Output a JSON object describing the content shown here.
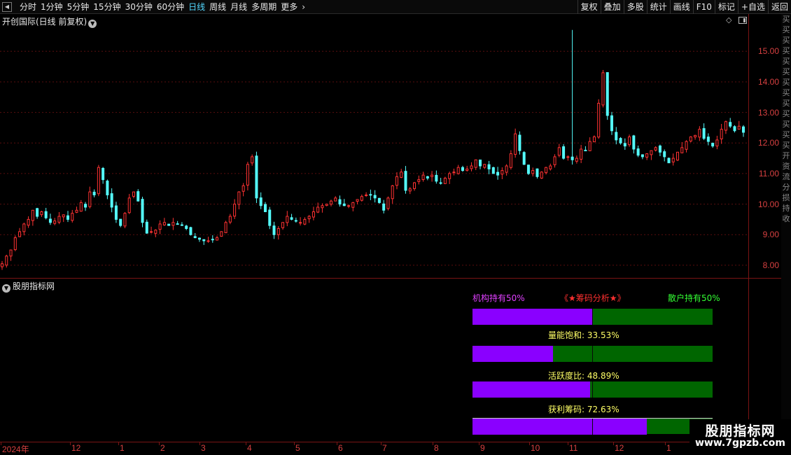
{
  "toolbar": {
    "tabs": [
      {
        "label": "分时",
        "active": false
      },
      {
        "label": "1分钟",
        "active": false
      },
      {
        "label": "5分钟",
        "active": false
      },
      {
        "label": "15分钟",
        "active": false
      },
      {
        "label": "30分钟",
        "active": false
      },
      {
        "label": "60分钟",
        "active": false
      },
      {
        "label": "日线",
        "active": true
      },
      {
        "label": "周线",
        "active": false
      },
      {
        "label": "月线",
        "active": false
      },
      {
        "label": "多周期",
        "active": false
      },
      {
        "label": "更多",
        "active": false
      }
    ],
    "right_buttons": [
      "复权",
      "叠加",
      "多股",
      "统计",
      "画线",
      "F10",
      "标记",
      "+自选",
      "返回"
    ]
  },
  "main_chart": {
    "title": "开创国际(日线 前复权)",
    "price_ticks": [
      "15.00",
      "14.00",
      "13.00",
      "12.00",
      "11.00",
      "10.00",
      "9.00",
      "8.00"
    ],
    "up_color": "#ff3232",
    "down_color": "#54fcfc"
  },
  "right_strip_glyphs": [
    "买",
    "买",
    "买",
    "买",
    "买",
    "买",
    "买",
    "买",
    "买",
    "买",
    "买",
    "买",
    "买",
    "开",
    "资",
    "流",
    "分",
    "损",
    "持",
    "收"
  ],
  "indicator": {
    "title": "股朋指标网",
    "institution_label": "机构持有50%",
    "analysis_title": "《★筹码分析★》",
    "retail_label": "散户持有50%",
    "volume_saturation": {
      "label": "量能饱和:",
      "value": "33.53%"
    },
    "activity_ratio": {
      "label": "活跃度比:",
      "value": "48.89%"
    },
    "profit_chips": {
      "label": "获利筹码:",
      "value": "72.63%"
    },
    "bars": [
      {
        "fill": 0.5
      },
      {
        "fill": 0.3353
      },
      {
        "fill": 0.4889
      },
      {
        "fill": 0.7263
      }
    ]
  },
  "date_axis": [
    "2024年",
    "12",
    "1",
    "2",
    "3",
    "4",
    "5",
    "6",
    "7",
    "8",
    "9",
    "10",
    "11",
    "12",
    "1"
  ],
  "watermark": {
    "title": "股朋指标网",
    "url": "www.7gpzb.com"
  },
  "chart_data": {
    "type": "candlestick",
    "ylim": [
      7.7,
      15.9
    ],
    "price_path": [
      8.05,
      8.3,
      8.5,
      8.9,
      9.1,
      9.35,
      9.5,
      9.8,
      9.6,
      9.75,
      9.55,
      9.4,
      9.45,
      9.6,
      9.65,
      9.5,
      9.7,
      9.8,
      10.05,
      9.9,
      10.4,
      10.3,
      11.2,
      10.8,
      10.3,
      9.9,
      9.5,
      9.3,
      9.7,
      10.2,
      10.4,
      10.1,
      9.4,
      9.05,
      9.1,
      9.15,
      9.35,
      9.4,
      9.3,
      9.4,
      9.35,
      9.3,
      9.2,
      9.0,
      8.9,
      8.85,
      8.8,
      8.8,
      8.85,
      8.9,
      9.1,
      9.4,
      9.6,
      10.0,
      10.4,
      10.6,
      11.3,
      11.55,
      10.2,
      9.95,
      9.75,
      9.3,
      9.0,
      9.2,
      9.4,
      9.6,
      9.5,
      9.45,
      9.4,
      9.5,
      9.6,
      9.75,
      9.9,
      9.95,
      10.0,
      10.1,
      10.2,
      10.0,
      9.95,
      9.95,
      10.05,
      10.15,
      10.25,
      10.3,
      10.3,
      10.2,
      10.05,
      9.8,
      10.2,
      10.6,
      10.9,
      11.05,
      10.45,
      10.5,
      10.7,
      10.8,
      10.95,
      10.85,
      10.95,
      10.75,
      10.7,
      10.85,
      11.0,
      11.05,
      11.2,
      11.1,
      11.15,
      11.25,
      11.45,
      11.25,
      11.3,
      11.15,
      11.0,
      10.95,
      11.1,
      11.25,
      11.65,
      12.3,
      11.75,
      11.3,
      11.0,
      11.1,
      10.9,
      11.05,
      11.2,
      11.25,
      11.55,
      11.85,
      11.5,
      11.55,
      11.45,
      11.5,
      11.8,
      11.75,
      12.05,
      12.2,
      13.3,
      14.3,
      12.9,
      12.4,
      12.1,
      12.0,
      11.9,
      12.2,
      11.8,
      11.6,
      11.55,
      11.65,
      11.75,
      11.85,
      11.7,
      11.55,
      11.35,
      11.5,
      11.7,
      11.85,
      12.05,
      12.2,
      12.25,
      12.45,
      12.15,
      12.05,
      11.9,
      12.1,
      12.45,
      12.7,
      12.55,
      12.4,
      12.55,
      12.35
    ]
  }
}
